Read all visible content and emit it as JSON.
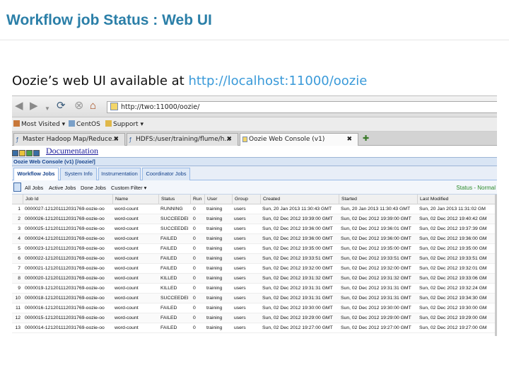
{
  "slide": {
    "title": "Workflow job Status : Web UI",
    "subtitle_text": "Oozie’s web UI available at ",
    "subtitle_link": "http://localhost:11000/oozie"
  },
  "browser": {
    "url": "http://two:11000/oozie/",
    "bookmarks": [
      "Most Visited ▾",
      "CentOS",
      "Support ▾"
    ],
    "tabs": [
      {
        "label": "Master Hadoop Map/Reduce...",
        "active": false
      },
      {
        "label": "HDFS:/user/training/flume/h...",
        "active": false
      },
      {
        "label": "Oozie Web Console (v1)",
        "active": true
      }
    ],
    "tab_close_glyph": "✖",
    "new_tab_glyph": "✚"
  },
  "app": {
    "documentation_link": "Documentation",
    "console_title": "Oozie Web Console (v1) [/oozie/]",
    "tabs": [
      "Workflow Jobs",
      "System Info",
      "Instrumentation",
      "Coordinator Jobs"
    ],
    "active_tab": "Workflow Jobs",
    "toolbar": [
      "All Jobs",
      "Active Jobs",
      "Done Jobs",
      "Custom Filter ▾"
    ],
    "status": "Status - Normal"
  },
  "grid": {
    "columns": [
      "Job Id",
      "Name",
      "Status",
      "Run",
      "User",
      "Group",
      "Created",
      "Started",
      "Last Modified"
    ],
    "rows": [
      [
        "1",
        "0000027-121201112031769-oozie-oo",
        "word-count",
        "RUNNING",
        "0",
        "training",
        "users",
        "Sun, 20 Jan 2013 11:30:43 GMT",
        "Sun, 20 Jan 2013 11:30:43 GMT",
        "Sun, 20 Jan 2013 11:31:02 GM"
      ],
      [
        "2",
        "0000026-121201112031769-oozie-oo",
        "word-count",
        "SUCCEEDEI",
        "0",
        "training",
        "users",
        "Sun, 02 Dec 2012 19:39:00 GMT",
        "Sun, 02 Dec 2012 19:39:00 GMT",
        "Sun, 02 Dec 2012 19:40:42 GM"
      ],
      [
        "3",
        "0000025-121201112031769-oozie-oo",
        "word-count",
        "SUCCEEDEI",
        "0",
        "training",
        "users",
        "Sun, 02 Dec 2012 19:36:00 GMT",
        "Sun, 02 Dec 2012 19:36:01 GMT",
        "Sun, 02 Dec 2012 19:37:39 GM"
      ],
      [
        "4",
        "0000024-121201112031769-oozie-oo",
        "word-count",
        "FAILED",
        "0",
        "training",
        "users",
        "Sun, 02 Dec 2012 19:36:00 GMT",
        "Sun, 02 Dec 2012 19:36:00 GMT",
        "Sun, 02 Dec 2012 19:36:00 GM"
      ],
      [
        "5",
        "0000023-121201112031769-oozie-oo",
        "word-count",
        "FAILED",
        "0",
        "training",
        "users",
        "Sun, 02 Dec 2012 19:35:00 GMT",
        "Sun, 02 Dec 2012 19:35:00 GMT",
        "Sun, 02 Dec 2012 19:35:00 GM"
      ],
      [
        "6",
        "0000022-121201112031769-oozie-oo",
        "word-count",
        "FAILED",
        "0",
        "training",
        "users",
        "Sun, 02 Dec 2012 19:33:51 GMT",
        "Sun, 02 Dec 2012 19:33:51 GMT",
        "Sun, 02 Dec 2012 19:33:51 GM"
      ],
      [
        "7",
        "0000021-121201112031769-oozie-oo",
        "word-count",
        "FAILED",
        "0",
        "training",
        "users",
        "Sun, 02 Dec 2012 19:32:00 GMT",
        "Sun, 02 Dec 2012 19:32:00 GMT",
        "Sun, 02 Dec 2012 19:32:01 GM"
      ],
      [
        "8",
        "0000020-121201112031769-oozie-oo",
        "word-count",
        "KILLED",
        "0",
        "training",
        "users",
        "Sun, 02 Dec 2012 19:31:32 GMT",
        "Sun, 02 Dec 2012 19:31:32 GMT",
        "Sun, 02 Dec 2012 19:33:06 GM"
      ],
      [
        "9",
        "0000019-121201112031769-oozie-oo",
        "word-count",
        "KILLED",
        "0",
        "training",
        "users",
        "Sun, 02 Dec 2012 19:31:31 GMT",
        "Sun, 02 Dec 2012 19:31:31 GMT",
        "Sun, 02 Dec 2012 19:32:24 GM"
      ],
      [
        "10",
        "0000018-121201112031769-oozie-oo",
        "word-count",
        "SUCCEEDEI",
        "0",
        "training",
        "users",
        "Sun, 02 Dec 2012 19:31:31 GMT",
        "Sun, 02 Dec 2012 19:31:31 GMT",
        "Sun, 02 Dec 2012 19:34:30 GM"
      ],
      [
        "11",
        "0000016-121201112031769-oozie-oo",
        "word-count",
        "FAILED",
        "0",
        "training",
        "users",
        "Sun, 02 Dec 2012 19:30:00 GMT",
        "Sun, 02 Dec 2012 19:30:00 GMT",
        "Sun, 02 Dec 2012 19:30:00 GM"
      ],
      [
        "12",
        "0000015-121201112031769-oozie-oo",
        "word-count",
        "FAILED",
        "0",
        "training",
        "users",
        "Sun, 02 Dec 2012 19:29:00 GMT",
        "Sun, 02 Dec 2012 19:29:00 GMT",
        "Sun, 02 Dec 2012 19:29:00 GM"
      ],
      [
        "13",
        "0000014-121201112031769-oozie-oo",
        "word-count",
        "FAILED",
        "0",
        "training",
        "users",
        "Sun, 02 Dec 2012 19:27:00 GMT",
        "Sun, 02 Dec 2012 19:27:00 GMT",
        "Sun, 02 Dec 2012 19:27:00 GM"
      ]
    ]
  },
  "icons": {
    "back": "back-arrow-icon",
    "forward": "forward-arrow-icon",
    "reload": "reload-icon",
    "stop": "stop-icon",
    "home": "home-icon"
  },
  "colors": {
    "title": "#2b7fa8",
    "link": "#3a9ad9",
    "status_normal": "#2a8a2a",
    "console_header_bg": "#d9e5f4"
  }
}
